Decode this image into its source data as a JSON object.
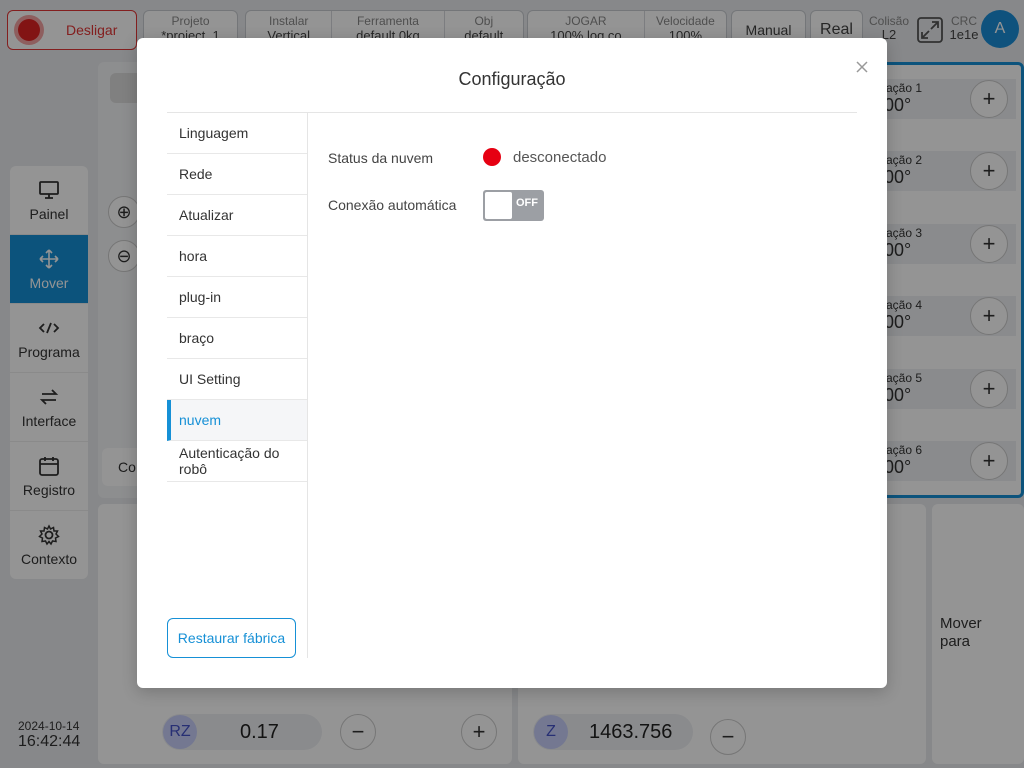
{
  "topbar": {
    "power_label": "Desligar",
    "project_key": "Projeto",
    "project_val": "*project_1",
    "install_key": "Instalar",
    "install_val": "Vertical",
    "tool_key": "Ferramenta",
    "tool_val": "default  0kg",
    "obj_key": "Obj",
    "obj_val": "default",
    "jog_key": "JOGAR",
    "jog_val": "100%  log.co",
    "speed_key": "Velocidade",
    "speed_val": "100%",
    "mode_label": "Manual",
    "real_label": "Real",
    "collision_key": "Colisão",
    "collision_val": "L2",
    "crc_key": "CRC",
    "crc_val": "1e1e",
    "avatar_letter": "A"
  },
  "leftnav": {
    "items": [
      {
        "label": "Painel",
        "icon": "monitor-icon"
      },
      {
        "label": "Mover",
        "icon": "move-icon"
      },
      {
        "label": "Programa",
        "icon": "code-icon"
      },
      {
        "label": "Interface",
        "icon": "swap-icon"
      },
      {
        "label": "Registro",
        "icon": "calendar-icon"
      },
      {
        "label": "Contexto",
        "icon": "gear-icon"
      }
    ]
  },
  "datetime": {
    "date": "2024-10-14",
    "time": "16:42:44"
  },
  "background": {
    "joints": [
      {
        "label": "ação 1",
        "value": "00°"
      },
      {
        "label": "ação 2",
        "value": "00°"
      },
      {
        "label": "ação 3",
        "value": "00°"
      },
      {
        "label": "ação 4",
        "value": "00°"
      },
      {
        "label": "ação 5",
        "value": "00°"
      },
      {
        "label": "ação 6",
        "value": "00°"
      }
    ],
    "rz_label": "RZ",
    "rz_value": "0.17",
    "z_label": "Z",
    "z_value": "1463.756",
    "move_to": "Mover para",
    "co_fragment": "Co"
  },
  "modal": {
    "title": "Configuração",
    "nav": [
      {
        "label": "Linguagem"
      },
      {
        "label": "Rede"
      },
      {
        "label": "Atualizar"
      },
      {
        "label": "hora"
      },
      {
        "label": "plug-in"
      },
      {
        "label": "braço"
      },
      {
        "label": "UI Setting"
      },
      {
        "label": "nuvem"
      },
      {
        "label": "Autenticação do robô"
      }
    ],
    "active_item": "nuvem",
    "restore_label": "Restaurar fábrica",
    "cloud_status_label": "Status da nuvem",
    "cloud_status_value": "desconectado",
    "auto_connect_label": "Conexão automática",
    "auto_connect_state": "OFF",
    "status_color": "#e60012",
    "accent_color": "#1690d6"
  }
}
